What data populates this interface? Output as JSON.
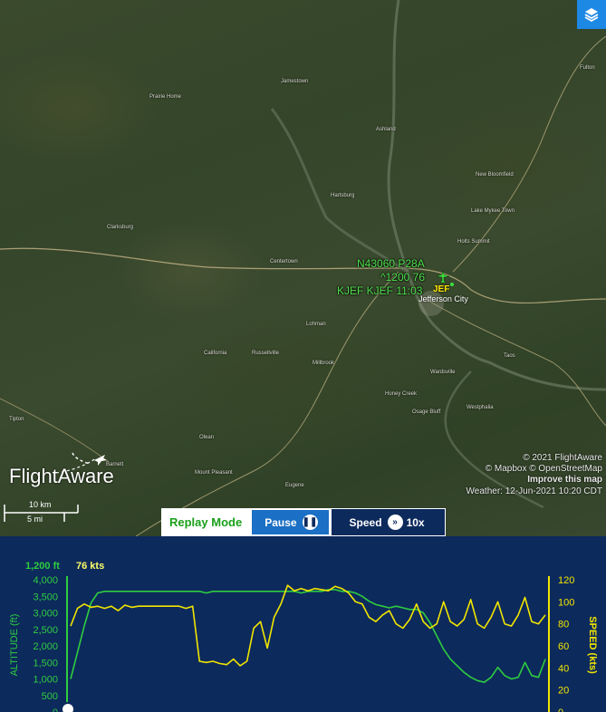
{
  "map": {
    "towns": [
      "Westphalia",
      "Jefferson City",
      "Holts Summit",
      "New Bloomfield",
      "Fulton",
      "Jamestown",
      "Prairie Home",
      "California",
      "Russellville",
      "Centertown",
      "Lohman",
      "Wardsville",
      "Eugene",
      "Clarksburg",
      "Tipton",
      "Hartsburg",
      "Ashland",
      "Lake Mykee Town",
      "Taos",
      "Olean",
      "Mount Pleasant",
      "Millbrook",
      "Honey Creek",
      "Osage Bluff",
      "Barnett"
    ],
    "layers_icon": "layers-icon"
  },
  "aircraft": {
    "line1": "N43060 P28A",
    "line2": "^1200 76",
    "line3": "KJEF KJEF 11:03",
    "airport": "JEF"
  },
  "credits": {
    "line1": "© 2021 FlightAware",
    "line2": "© Mapbox © OpenStreetMap",
    "line3": "Improve this map",
    "weather": "Weather: 12-Jun-2021 10:20 CDT"
  },
  "logo": "FlightAware",
  "scale": {
    "km": "10 km",
    "mi": "5 mi"
  },
  "replay": {
    "mode_label": "Replay Mode",
    "pause_label": "Pause",
    "speed_label": "Speed",
    "speed_value": "10x"
  },
  "chart_data": {
    "type": "line",
    "current_altitude": "1,200 ft",
    "current_speed": "76 kts",
    "ylabel": "ALTITUDE (ft)",
    "y2label": "SPEED (kts)",
    "ylim": [
      0,
      4000
    ],
    "y2lim": [
      0,
      120
    ],
    "yticks": [
      "4,000",
      "3,500",
      "3,000",
      "2,500",
      "2,000",
      "1,500",
      "1,000",
      "500",
      "0"
    ],
    "y2ticks": [
      "120",
      "100",
      "80",
      "60",
      "40",
      "20",
      "0"
    ],
    "colors": {
      "altitude": "#2ecc40",
      "speed": "#f2e600",
      "background": "#0d2a5c"
    },
    "series": [
      {
        "key": "altitude",
        "x": [
          0,
          1,
          2,
          3,
          4,
          5,
          6,
          7,
          8,
          9,
          10,
          11,
          12,
          13,
          14,
          15,
          16,
          17,
          18,
          19,
          20,
          21,
          22,
          23,
          24,
          25,
          26,
          27,
          28,
          29,
          30,
          31,
          32,
          33,
          34,
          35,
          36,
          37,
          38,
          39,
          40,
          41,
          42,
          43,
          44,
          45,
          46,
          47,
          48,
          49,
          50,
          51,
          52,
          53,
          54,
          55,
          56,
          57,
          58,
          59,
          60,
          61,
          62,
          63,
          64,
          65,
          66,
          67,
          68,
          69,
          70
        ],
        "values": [
          1000,
          1800,
          2600,
          3300,
          3600,
          3650,
          3650,
          3650,
          3650,
          3650,
          3650,
          3650,
          3650,
          3650,
          3650,
          3650,
          3650,
          3650,
          3650,
          3650,
          3600,
          3650,
          3650,
          3650,
          3650,
          3650,
          3650,
          3650,
          3650,
          3650,
          3650,
          3650,
          3650,
          3650,
          3600,
          3650,
          3650,
          3650,
          3700,
          3700,
          3650,
          3650,
          3600,
          3500,
          3350,
          3250,
          3200,
          3150,
          3200,
          3150,
          3100,
          3100,
          3000,
          2700,
          2300,
          1900,
          1600,
          1400,
          1200,
          1050,
          950,
          900,
          1050,
          1350,
          1100,
          1000,
          1050,
          1500,
          1100,
          1050,
          1600
        ]
      },
      {
        "key": "speed",
        "x": [
          0,
          1,
          2,
          3,
          4,
          5,
          6,
          7,
          8,
          9,
          10,
          11,
          12,
          13,
          14,
          15,
          16,
          17,
          18,
          19,
          20,
          21,
          22,
          23,
          24,
          25,
          26,
          27,
          28,
          29,
          30,
          31,
          32,
          33,
          34,
          35,
          36,
          37,
          38,
          39,
          40,
          41,
          42,
          43,
          44,
          45,
          46,
          47,
          48,
          49,
          50,
          51,
          52,
          53,
          54,
          55,
          56,
          57,
          58,
          59,
          60,
          61,
          62,
          63,
          64,
          65,
          66,
          67,
          68,
          69,
          70
        ],
        "values": [
          78,
          94,
          98,
          95,
          96,
          94,
          96,
          92,
          97,
          95,
          96,
          96,
          96,
          96,
          96,
          96,
          96,
          94,
          96,
          46,
          45,
          46,
          44,
          43,
          48,
          42,
          46,
          76,
          82,
          58,
          86,
          98,
          115,
          110,
          112,
          110,
          112,
          111,
          110,
          114,
          112,
          108,
          100,
          98,
          86,
          82,
          88,
          92,
          80,
          76,
          84,
          98,
          82,
          76,
          80,
          100,
          82,
          78,
          84,
          102,
          80,
          76,
          86,
          100,
          80,
          78,
          88,
          104,
          82,
          80,
          88
        ]
      }
    ]
  }
}
